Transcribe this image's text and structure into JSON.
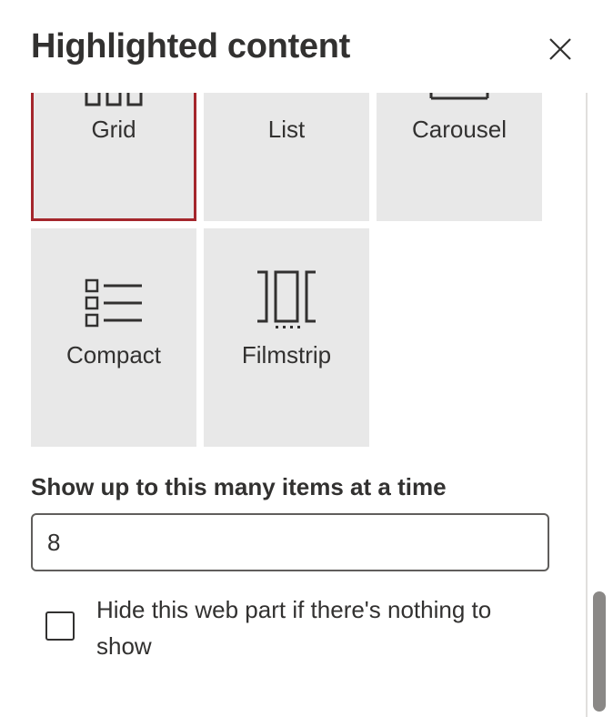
{
  "panel": {
    "title": "Highlighted content",
    "close_icon": "close-icon"
  },
  "layouts": [
    {
      "id": "grid",
      "label": "Grid",
      "icon": "grid-icon",
      "selected": true
    },
    {
      "id": "list",
      "label": "List",
      "icon": "list-icon",
      "selected": false
    },
    {
      "id": "carousel",
      "label": "Carousel",
      "icon": "carousel-icon",
      "selected": false
    },
    {
      "id": "compact",
      "label": "Compact",
      "icon": "compact-list-icon",
      "selected": false
    },
    {
      "id": "filmstrip",
      "label": "Filmstrip",
      "icon": "filmstrip-icon",
      "selected": false
    }
  ],
  "items_count": {
    "label": "Show up to this many items at a time",
    "value": "8"
  },
  "hide_option": {
    "label": "Hide this web part if there's nothing to show",
    "checked": false
  },
  "colors": {
    "selected_border": "#a4262c",
    "tile_background": "#e8e8e8",
    "text": "#323130"
  }
}
